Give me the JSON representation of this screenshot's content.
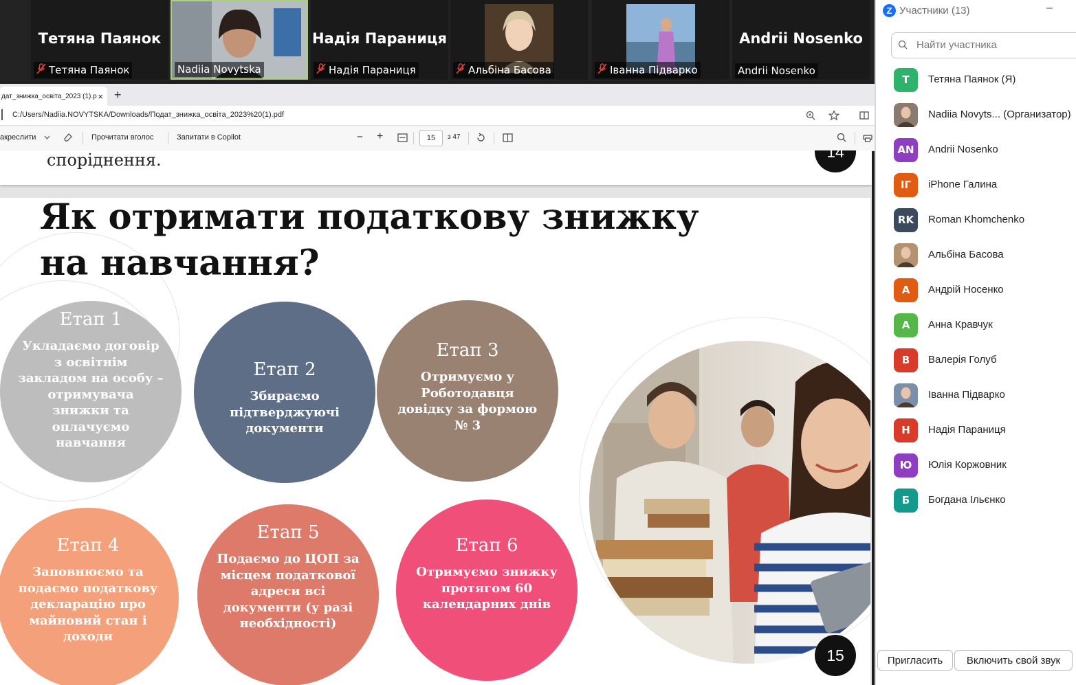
{
  "videos": [
    {
      "big_name": "Тетяна Паянок",
      "label": "Тетяна Паянок",
      "muted": true,
      "photo": false
    },
    {
      "big_name": "",
      "label": "Nadiia Novytska",
      "muted": false,
      "photo": true,
      "active": true
    },
    {
      "big_name": "Надія Параниця",
      "label": "Надія Параниця",
      "muted": true,
      "photo": false
    },
    {
      "big_name": "",
      "label": "Альбіна Басова",
      "muted": true,
      "photo": true
    },
    {
      "big_name": "",
      "label": "Іванна Підварко",
      "muted": true,
      "photo": true
    },
    {
      "big_name": "Andrii Nosenko",
      "label": "Andrii Nosenko",
      "muted": false,
      "photo": false
    }
  ],
  "browser": {
    "tab_title": "дат_знижка_освіта_2023 (1).p",
    "tab_close": "×",
    "new_tab": "+",
    "url": "C:/Users/Nadiia.NOVYTSKA/Downloads/Подат_знижка_освіта_2023%20(1).pdf"
  },
  "toolbar": {
    "draw": "акреслити",
    "read_aloud": "Прочитати вголос",
    "copilot": "Запитати в Copilot",
    "zoom_out": "−",
    "zoom_in": "+",
    "page_current": "15",
    "page_total": "з 47"
  },
  "pdf": {
    "prev_page_text": "споріднення.",
    "prev_page_number": "14",
    "title": "Як отримати податкову знижку на навчання?",
    "page_number": "15",
    "stages": [
      {
        "title": "Етап 1",
        "text": "Укладаємо договір з освітнім закладом на особу – отримувача знижки та оплачуємо навчання",
        "color": "#bdbdbd"
      },
      {
        "title": "Етап 2",
        "text": "Збираємо підтверджуючі документи",
        "color": "#5e6e87"
      },
      {
        "title": "Етап 3",
        "text": "Отримуємо у Роботодавця довідку  за формою № 3",
        "color": "#9a8273"
      },
      {
        "title": "Етап 4",
        "text": "Заповнюємо та подаємо податкову декларацію про майновий стан і доходи",
        "color": "#f4a07a"
      },
      {
        "title": "Етап 5",
        "text": "Подаємо до ЦОП за місцем податкової адреси всі документи (у разі необхідності)",
        "color": "#dd7a6a"
      },
      {
        "title": "Етап 6",
        "text": "Отримуємо знижку протягом 60 календарних днів",
        "color": "#ef4f78"
      }
    ]
  },
  "panel": {
    "title": "Участники (13)",
    "minimize": "–",
    "search_placeholder": "Найти участника",
    "participants": [
      {
        "initials": "Т",
        "name": "Тетяна Паянок (Я)",
        "color": "#2fb36c"
      },
      {
        "initials": "",
        "name": "Nadiia Novyts...  (Организатор)",
        "color": "#8a7a70",
        "photo": true
      },
      {
        "initials": "AN",
        "name": "Andrii Nosenko",
        "color": "#8e3fc1"
      },
      {
        "initials": "ІГ",
        "name": "iPhone Галина",
        "color": "#e05c12"
      },
      {
        "initials": "RK",
        "name": "Roman Khomchenko",
        "color": "#3c4a5e"
      },
      {
        "initials": "",
        "name": "Альбіна Басова",
        "color": "#b29270",
        "photo": true
      },
      {
        "initials": "А",
        "name": "Андрій Носенко",
        "color": "#e05c12"
      },
      {
        "initials": "А",
        "name": "Анна Кравчук",
        "color": "#56b64a"
      },
      {
        "initials": "В",
        "name": "Валерія Голуб",
        "color": "#d93b2b"
      },
      {
        "initials": "",
        "name": "Іванна Підварко",
        "color": "#7c8fa8",
        "photo": true
      },
      {
        "initials": "Н",
        "name": "Надія Параниця",
        "color": "#d93b2b"
      },
      {
        "initials": "Ю",
        "name": "Юлія Коржовник",
        "color": "#8e3fc1"
      },
      {
        "initials": "Б",
        "name": "Богдана Ільєнко",
        "color": "#139a8c"
      }
    ],
    "invite_button": "Пригласить",
    "unmute_button": "Включить свой звук"
  }
}
